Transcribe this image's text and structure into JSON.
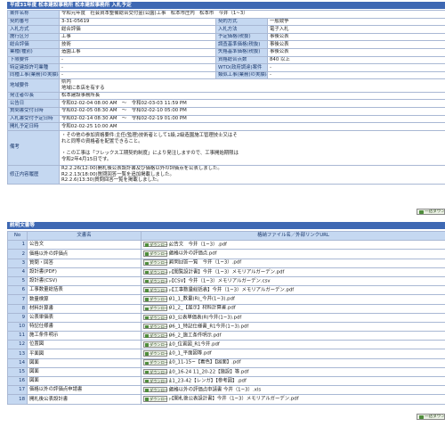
{
  "header": {
    "title": "平成31年度 松本建設事務所 松本建設事務所 入札予定"
  },
  "info_rows": [
    {
      "l1": "案件名称",
      "v1": "令和元年度　社会資本整備総合交付金(公園)工事　松本市庄内　松本市　今井（1~3）",
      "l2": "",
      "v2": ""
    },
    {
      "l1": "契約番号",
      "v1": "3-31-05619",
      "l2": "契約方式",
      "v2": "一般競争"
    },
    {
      "l1": "入札方式",
      "v1": "総合評価",
      "l2": "入札方法",
      "v2": "電子入札"
    },
    {
      "l1": "施行区分",
      "v1": "工事",
      "l2": "予定価格(税抜)",
      "v2": "事後公表"
    },
    {
      "l1": "総合評価",
      "v1": "技術",
      "l2": "調査基準価格(税抜)",
      "v2": "事後公表"
    },
    {
      "l1": "業種(種別)",
      "v1": "造園工事",
      "l2": "失格基準価格(税抜)",
      "v2": "事後公表"
    },
    {
      "l1": "下限要件",
      "v1": "-",
      "l2": "資格総合点数",
      "v2": "840 以上"
    },
    {
      "l1": "特定建設許可業種",
      "v1": "-",
      "l2": "WTO(政府調達)案件",
      "v2": "-"
    },
    {
      "l1": "同種工事(業務)の実績に関する要件",
      "v1": "-",
      "l2": "類似工事(業務)の実績に関する要件",
      "v2": "-"
    },
    {
      "l1": "地域要件",
      "v1": "県内\n地域に本店を有する",
      "l2": "",
      "v2": ""
    },
    {
      "l1": "発注者の長",
      "v1": "松本建設事務所長",
      "l2": "",
      "v2": ""
    },
    {
      "l1": "公告日",
      "v1": "令和02-02-04 08:00 AM　～　令和02-03-03 11:59 PM",
      "l2": "",
      "v2": ""
    },
    {
      "l1": "質問書受付日時",
      "v1": "令和02-02-05 08:30 AM　～　令和02-02-10 05:00 PM",
      "l2": "",
      "v2": ""
    },
    {
      "l1": "入札書受付予定日時",
      "v1": "令和02-02-14 08:30 AM　～　令和02-02-19 01:00 PM",
      "l2": "",
      "v2": ""
    },
    {
      "l1": "開札予定日時",
      "v1": "令和02-02-25 10:00 AM",
      "l2": "",
      "v2": ""
    }
  ],
  "remarks": {
    "label": "備考",
    "lines": [
      "・その他の参加資格要件:主任(監理)技術者として1級,2級造園施工管理技士又はそ",
      "れと同等の資格者を配置できること。",
      "",
      "・この工事は「フレックス工期契約制度」により発注しますので、工事開始期限は",
      "令和2年4月15日です。"
    ]
  },
  "revision": {
    "label": "修正内容履歴",
    "lines": [
      "R2.2.26(12:00)開札後公表設計書及び価格以外の評価点を公表しました。",
      "R2.2.13(18:00)質問回答一覧を追加掲載しました。",
      "R2.2.6(13:30)質問回答一覧を掲載しました。"
    ]
  },
  "top_button": {
    "label": "一括ダウンロード"
  },
  "bottom_button": {
    "label": "一括ダウンロード"
  },
  "docs": {
    "section_title": "説明文書等",
    "col_no": "No",
    "col_name": "文書名",
    "col_file": "格納ファイル名／外部リンクURL",
    "dl_label": "ダウンロード",
    "rows": [
      {
        "no": "1",
        "name": "公告文",
        "file": "公告文　今井（1~3）.pdf"
      },
      {
        "no": "2",
        "name": "価格以外の評価点",
        "file": "価格以外の評価点.pdf"
      },
      {
        "no": "3",
        "name": "質問・回答",
        "file": "質問回答一覧　今井（1~3）.pdf"
      },
      {
        "no": "4",
        "name": "設計書(PDF)",
        "file": "【閲覧設計書】今井（1~3）メモリアルガーデン.pdf"
      },
      {
        "no": "5",
        "name": "設計書(CSV)",
        "file": "【CSV】今井（1~3）メモリアルガーデン.csv"
      },
      {
        "no": "6",
        "name": "工事数量総括表",
        "file": "【工事数量総括表】今井（1~3）メモリアルガーデン.pdf"
      },
      {
        "no": "7",
        "name": "数量検算",
        "file": "01_1_数量(R)_今井(1~3).pdf"
      },
      {
        "no": "8",
        "name": "材料計算書",
        "file": "01_2_【展示】材料計算書.pdf"
      },
      {
        "no": "9",
        "name": "公表単価表",
        "file": "03_公表単価表(R)今井(1~3).pdf"
      },
      {
        "no": "10",
        "name": "特記仕様書",
        "file": "06_1_特記仕様書_R1今井(1~3).pdf"
      },
      {
        "no": "11",
        "name": "施工条件明示",
        "file": "06_2_施工条件明示.pdf"
      },
      {
        "no": "12",
        "name": "位置図",
        "file": "10_位置図_R1今井.pdf"
      },
      {
        "no": "13",
        "name": "平面図",
        "file": "10_1_平面図等.pdf"
      },
      {
        "no": "14",
        "name": "図面",
        "file": "10_11-15~【着色】【図面】.pdf"
      },
      {
        "no": "15",
        "name": "図面",
        "file": "10_16-24 11_20-22【施設】等.pdf"
      },
      {
        "no": "16",
        "name": "図面",
        "file": "11_23-42【レンガ】【参考図】.pdf"
      },
      {
        "no": "17",
        "name": "価格以外の評価点申請書",
        "file": "価格以外の評価点申請書 今井（1~3）.xls"
      },
      {
        "no": "18",
        "name": "開札後公表設計書",
        "file": "【開札後公表設計書】今井（1~3）メモリアルガーデン.pdf"
      }
    ]
  }
}
